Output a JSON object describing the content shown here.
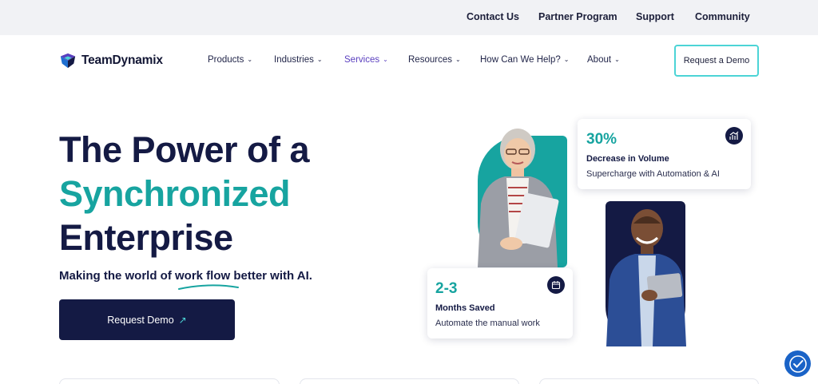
{
  "utility_bar": {
    "links": [
      "Contact Us",
      "Partner Program",
      "Support",
      "Community"
    ]
  },
  "nav": {
    "logo_text": "TeamDynamix",
    "items": [
      {
        "label": "Products",
        "active": false
      },
      {
        "label": "Industries",
        "active": false
      },
      {
        "label": "Services",
        "active": true
      },
      {
        "label": "Resources",
        "active": false
      },
      {
        "label": "How Can We Help?",
        "active": false
      },
      {
        "label": "About",
        "active": false
      }
    ],
    "cta_label": "Request a Demo"
  },
  "hero": {
    "title_line1": "The Power of a",
    "title_line2": "Synchronized",
    "title_line3": "Enterprise",
    "subtitle": "Making the world of work flow better with AI.",
    "cta_label": "Request Demo",
    "cta_icon": "arrow-up-right-icon"
  },
  "stats": [
    {
      "value": "30%",
      "title": "Decrease in Volume",
      "desc": "Supercharge with Automation & AI",
      "icon": "chart-icon"
    },
    {
      "value": "2-3",
      "title": "Months Saved",
      "desc": "Automate the manual work",
      "icon": "calendar-icon"
    }
  ],
  "colors": {
    "navy": "#141a44",
    "teal": "#17a4a0",
    "active_nav": "#5a3fbf",
    "cta_border": "#4cd4d6",
    "utility_bg": "#f1f2f5"
  }
}
